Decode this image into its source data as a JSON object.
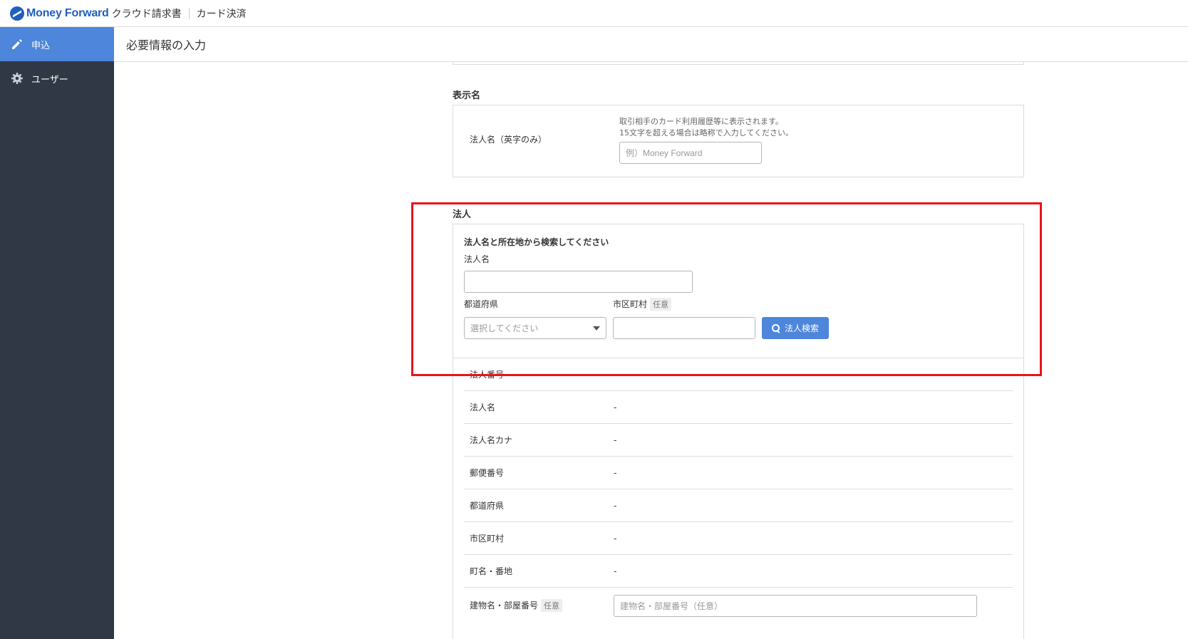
{
  "topbar": {
    "brand": "Money Forward",
    "product": "クラウド請求書",
    "service": "カード決済"
  },
  "sidebar": {
    "items": [
      {
        "label": "申込",
        "icon": "pencil-icon",
        "active": true
      },
      {
        "label": "ユーザー",
        "icon": "gear-icon",
        "active": false
      }
    ]
  },
  "header": {
    "title": "必要情報の入力"
  },
  "display_name": {
    "section_title": "表示名",
    "field_label": "法人名（英字のみ）",
    "hint_line1": "取引相手のカード利用履歴等に表示されます。",
    "hint_line2": "15文字を超える場合は略称で入力してください。",
    "placeholder": "例）Money Forward"
  },
  "corporation": {
    "section_title": "法人",
    "search_heading": "法人名と所在地から検索してください",
    "name_label": "法人名",
    "name_value": "",
    "prefecture_label": "都道府県",
    "prefecture_placeholder": "選択してください",
    "city_label": "市区町村",
    "optional_badge": "任意",
    "city_value": "",
    "search_button": "法人検索",
    "rows": [
      {
        "label": "法人番号",
        "value": "-"
      },
      {
        "label": "法人名",
        "value": "-"
      },
      {
        "label": "法人名カナ",
        "value": "-"
      },
      {
        "label": "郵便番号",
        "value": "-"
      },
      {
        "label": "都道府県",
        "value": "-"
      },
      {
        "label": "市区町村",
        "value": "-"
      },
      {
        "label": "町名・番地",
        "value": "-"
      }
    ],
    "building_label": "建物名・部屋番号",
    "building_optional": "任意",
    "building_placeholder": "建物名・部屋番号（任意）"
  },
  "colors": {
    "primary": "#4d86db",
    "sidebar": "#313845",
    "highlight": "#e8141b"
  }
}
